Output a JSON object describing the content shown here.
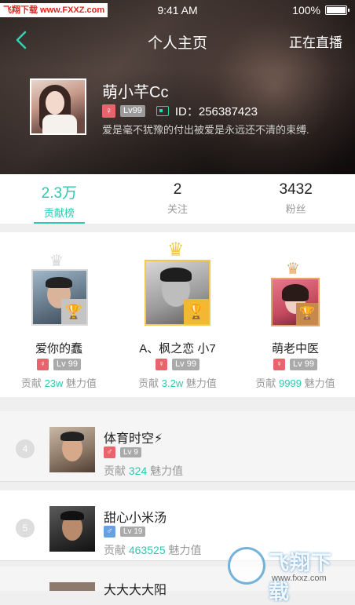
{
  "watermark_top": "飞翔下载 www.FXXZ.com",
  "status": {
    "time": "9:41 AM",
    "battery": "100%"
  },
  "nav": {
    "title": "个人主页",
    "right": "正在直播"
  },
  "profile": {
    "name": "萌小芊Cc",
    "gender": "♀",
    "level": "Lv99",
    "id": "ID：256387423",
    "signature": "爱是毫不犹豫的付出被爱是永远还不清的束缚."
  },
  "stats": [
    {
      "value": "2.3万",
      "label": "贡献榜"
    },
    {
      "value": "2",
      "label": "关注"
    },
    {
      "value": "3432",
      "label": "粉丝"
    }
  ],
  "top3": [
    {
      "name": "爱你的蠢",
      "gender": "♀",
      "level": "Lv 99",
      "contrib_prefix": "贡献",
      "contrib": "23w",
      "contrib_suffix": "魅力值",
      "crown_color": "#d8d8d8"
    },
    {
      "name": "A、枫之恋 小7",
      "gender": "♀",
      "level": "Lv 99",
      "contrib_prefix": "贡献",
      "contrib": "3.2w",
      "contrib_suffix": "魅力值",
      "crown_color": "#f2c94c"
    },
    {
      "name": "萌老中医",
      "gender": "♀",
      "level": "Lv 99",
      "contrib_prefix": "贡献",
      "contrib": "9999",
      "contrib_suffix": "魅力值",
      "crown_color": "#e0a86a"
    }
  ],
  "list": [
    {
      "rank": "4",
      "name": "体育时空⚡",
      "gender": "♂",
      "level": "Lv 9",
      "contrib_prefix": "贡献",
      "contrib": "324",
      "contrib_suffix": "魅力值"
    },
    {
      "rank": "5",
      "name": "甜心小米汤",
      "gender": "♂",
      "level": "Lv 19",
      "contrib_prefix": "贡献",
      "contrib": "463525",
      "contrib_suffix": "魅力值"
    },
    {
      "rank": "",
      "name": "大大大大阳",
      "gender": "",
      "level": "",
      "contrib_prefix": "",
      "contrib": "",
      "contrib_suffix": ""
    }
  ],
  "watermark_bottom": {
    "text": "飞翔下载",
    "url": "www.fxxz.com"
  },
  "colors": {
    "accent": "#2cc9b0",
    "female": "#e9636c",
    "male": "#6aa0e0"
  }
}
